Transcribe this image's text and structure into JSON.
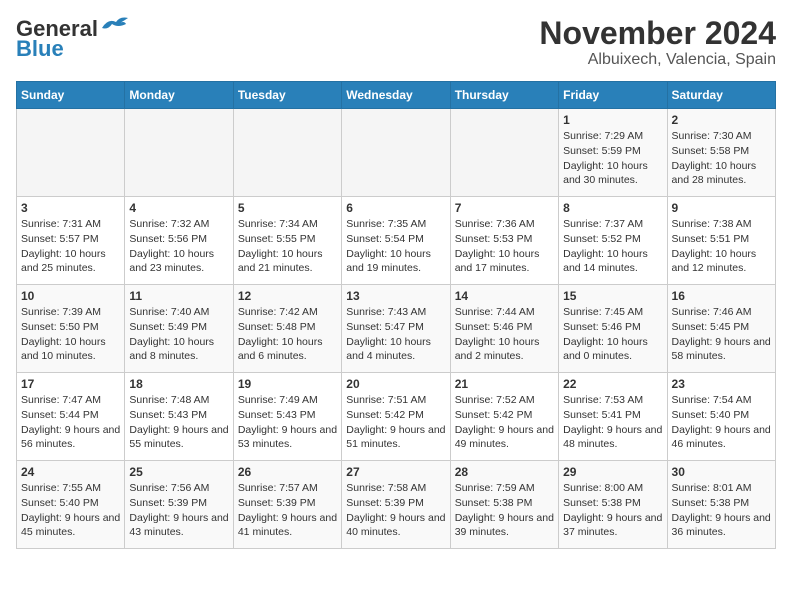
{
  "header": {
    "logo_line1": "General",
    "logo_line2": "Blue",
    "title": "November 2024",
    "subtitle": "Albuixech, Valencia, Spain"
  },
  "days_of_week": [
    "Sunday",
    "Monday",
    "Tuesday",
    "Wednesday",
    "Thursday",
    "Friday",
    "Saturday"
  ],
  "weeks": [
    [
      {
        "num": "",
        "info": ""
      },
      {
        "num": "",
        "info": ""
      },
      {
        "num": "",
        "info": ""
      },
      {
        "num": "",
        "info": ""
      },
      {
        "num": "",
        "info": ""
      },
      {
        "num": "1",
        "info": "Sunrise: 7:29 AM\nSunset: 5:59 PM\nDaylight: 10 hours and 30 minutes."
      },
      {
        "num": "2",
        "info": "Sunrise: 7:30 AM\nSunset: 5:58 PM\nDaylight: 10 hours and 28 minutes."
      }
    ],
    [
      {
        "num": "3",
        "info": "Sunrise: 7:31 AM\nSunset: 5:57 PM\nDaylight: 10 hours and 25 minutes."
      },
      {
        "num": "4",
        "info": "Sunrise: 7:32 AM\nSunset: 5:56 PM\nDaylight: 10 hours and 23 minutes."
      },
      {
        "num": "5",
        "info": "Sunrise: 7:34 AM\nSunset: 5:55 PM\nDaylight: 10 hours and 21 minutes."
      },
      {
        "num": "6",
        "info": "Sunrise: 7:35 AM\nSunset: 5:54 PM\nDaylight: 10 hours and 19 minutes."
      },
      {
        "num": "7",
        "info": "Sunrise: 7:36 AM\nSunset: 5:53 PM\nDaylight: 10 hours and 17 minutes."
      },
      {
        "num": "8",
        "info": "Sunrise: 7:37 AM\nSunset: 5:52 PM\nDaylight: 10 hours and 14 minutes."
      },
      {
        "num": "9",
        "info": "Sunrise: 7:38 AM\nSunset: 5:51 PM\nDaylight: 10 hours and 12 minutes."
      }
    ],
    [
      {
        "num": "10",
        "info": "Sunrise: 7:39 AM\nSunset: 5:50 PM\nDaylight: 10 hours and 10 minutes."
      },
      {
        "num": "11",
        "info": "Sunrise: 7:40 AM\nSunset: 5:49 PM\nDaylight: 10 hours and 8 minutes."
      },
      {
        "num": "12",
        "info": "Sunrise: 7:42 AM\nSunset: 5:48 PM\nDaylight: 10 hours and 6 minutes."
      },
      {
        "num": "13",
        "info": "Sunrise: 7:43 AM\nSunset: 5:47 PM\nDaylight: 10 hours and 4 minutes."
      },
      {
        "num": "14",
        "info": "Sunrise: 7:44 AM\nSunset: 5:46 PM\nDaylight: 10 hours and 2 minutes."
      },
      {
        "num": "15",
        "info": "Sunrise: 7:45 AM\nSunset: 5:46 PM\nDaylight: 10 hours and 0 minutes."
      },
      {
        "num": "16",
        "info": "Sunrise: 7:46 AM\nSunset: 5:45 PM\nDaylight: 9 hours and 58 minutes."
      }
    ],
    [
      {
        "num": "17",
        "info": "Sunrise: 7:47 AM\nSunset: 5:44 PM\nDaylight: 9 hours and 56 minutes."
      },
      {
        "num": "18",
        "info": "Sunrise: 7:48 AM\nSunset: 5:43 PM\nDaylight: 9 hours and 55 minutes."
      },
      {
        "num": "19",
        "info": "Sunrise: 7:49 AM\nSunset: 5:43 PM\nDaylight: 9 hours and 53 minutes."
      },
      {
        "num": "20",
        "info": "Sunrise: 7:51 AM\nSunset: 5:42 PM\nDaylight: 9 hours and 51 minutes."
      },
      {
        "num": "21",
        "info": "Sunrise: 7:52 AM\nSunset: 5:42 PM\nDaylight: 9 hours and 49 minutes."
      },
      {
        "num": "22",
        "info": "Sunrise: 7:53 AM\nSunset: 5:41 PM\nDaylight: 9 hours and 48 minutes."
      },
      {
        "num": "23",
        "info": "Sunrise: 7:54 AM\nSunset: 5:40 PM\nDaylight: 9 hours and 46 minutes."
      }
    ],
    [
      {
        "num": "24",
        "info": "Sunrise: 7:55 AM\nSunset: 5:40 PM\nDaylight: 9 hours and 45 minutes."
      },
      {
        "num": "25",
        "info": "Sunrise: 7:56 AM\nSunset: 5:39 PM\nDaylight: 9 hours and 43 minutes."
      },
      {
        "num": "26",
        "info": "Sunrise: 7:57 AM\nSunset: 5:39 PM\nDaylight: 9 hours and 41 minutes."
      },
      {
        "num": "27",
        "info": "Sunrise: 7:58 AM\nSunset: 5:39 PM\nDaylight: 9 hours and 40 minutes."
      },
      {
        "num": "28",
        "info": "Sunrise: 7:59 AM\nSunset: 5:38 PM\nDaylight: 9 hours and 39 minutes."
      },
      {
        "num": "29",
        "info": "Sunrise: 8:00 AM\nSunset: 5:38 PM\nDaylight: 9 hours and 37 minutes."
      },
      {
        "num": "30",
        "info": "Sunrise: 8:01 AM\nSunset: 5:38 PM\nDaylight: 9 hours and 36 minutes."
      }
    ]
  ]
}
